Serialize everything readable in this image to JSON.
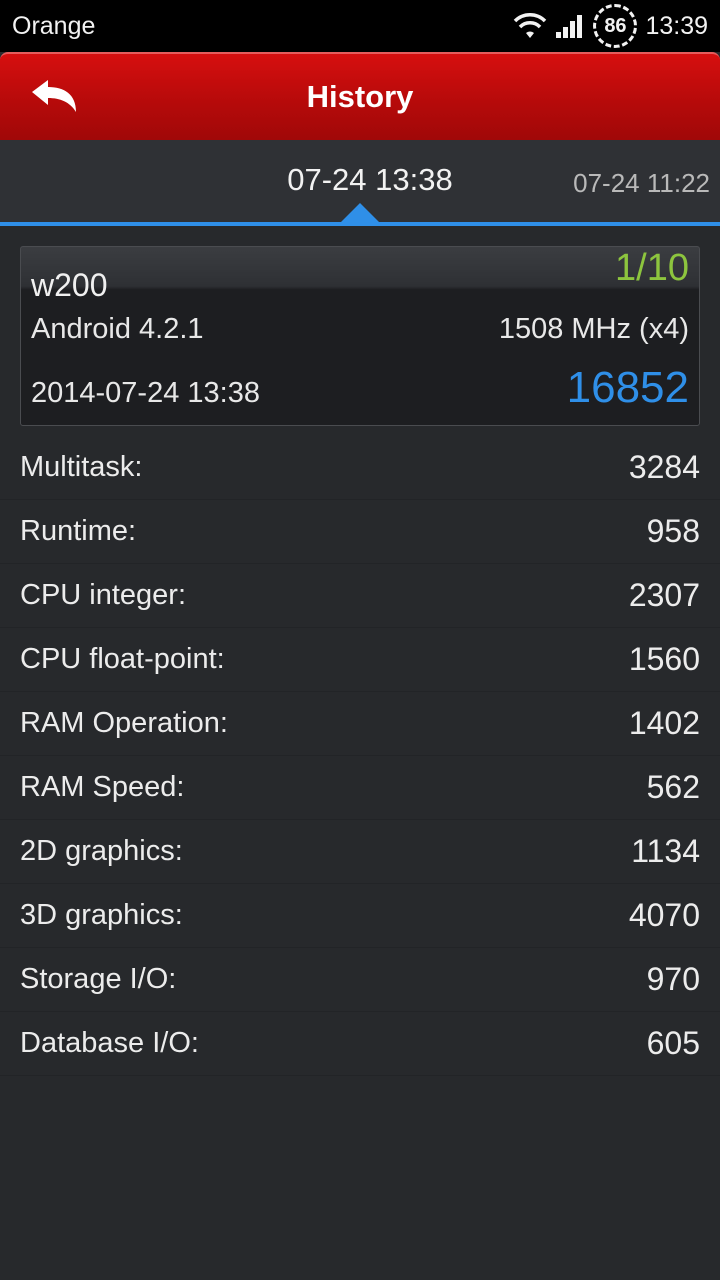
{
  "status_bar": {
    "carrier": "Orange",
    "battery": "86",
    "time": "13:39"
  },
  "header": {
    "title": "History"
  },
  "tabs": {
    "active": "07-24 13:38",
    "other": "07-24 11:22"
  },
  "summary": {
    "device": "w200",
    "rank": "1/10",
    "os": "Android 4.2.1",
    "cpu": "1508 MHz (x4)",
    "date": "2014-07-24 13:38",
    "total": "16852"
  },
  "scores": [
    {
      "label": "Multitask:",
      "value": "3284"
    },
    {
      "label": "Runtime:",
      "value": "958"
    },
    {
      "label": "CPU integer:",
      "value": "2307"
    },
    {
      "label": "CPU float-point:",
      "value": "1560"
    },
    {
      "label": "RAM Operation:",
      "value": "1402"
    },
    {
      "label": "RAM Speed:",
      "value": "562"
    },
    {
      "label": "2D graphics:",
      "value": "1134"
    },
    {
      "label": "3D graphics:",
      "value": "4070"
    },
    {
      "label": "Storage I/O:",
      "value": "970"
    },
    {
      "label": "Database I/O:",
      "value": "605"
    }
  ],
  "colors": {
    "header_red": "#c40c0c",
    "accent_blue": "#2f8fe8",
    "rank_green": "#8dc53e"
  },
  "icons": {
    "back": "back-arrow-icon",
    "wifi": "wifi-icon",
    "signal": "signal-icon",
    "battery": "battery-icon"
  }
}
